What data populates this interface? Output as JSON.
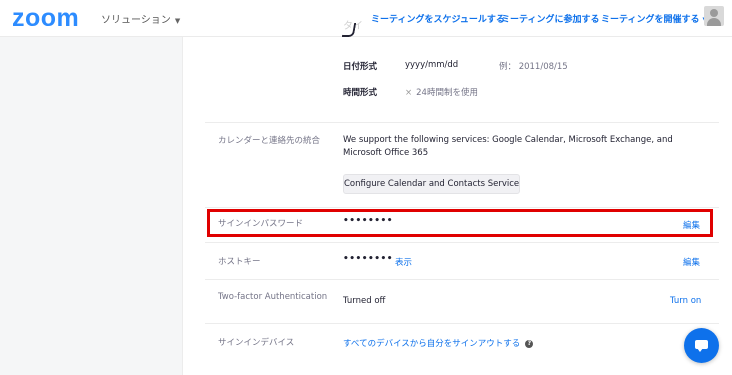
{
  "header": {
    "logo": "zoom",
    "solutions_label": "ソリューション",
    "nav": {
      "schedule": "ミーティングをスケジュールする",
      "join": "ミーティングに参加する",
      "host": "ミーティングを開催する"
    }
  },
  "date_settings": {
    "date_format_label": "日付形式",
    "date_format_value": "yyyy/mm/dd",
    "date_example": "例：  2011/08/15",
    "time_format_label": "時間形式",
    "time_format_value": "24時間制を使用"
  },
  "calendar": {
    "label": "カレンダーと連絡先の統合",
    "description": "We support the following services: Google Calendar, Microsoft Exchange, and Microsoft Office 365",
    "button": "Configure Calendar and Contacts Service"
  },
  "signin_password": {
    "label": "サインインパスワード",
    "value": "••••••••",
    "edit": "編集"
  },
  "host_key": {
    "label": "ホストキー",
    "value": "••••••••",
    "show": "表示",
    "edit": "編集"
  },
  "two_factor": {
    "label": "Two-factor Authentication",
    "status": "Turned off",
    "action": "Turn on"
  },
  "signin_device": {
    "label": "サインインデバイス",
    "action": "すべてのデバイスから自分をサインアウトする"
  },
  "colors": {
    "accent": "#0e71eb",
    "highlight": "#e00000"
  }
}
